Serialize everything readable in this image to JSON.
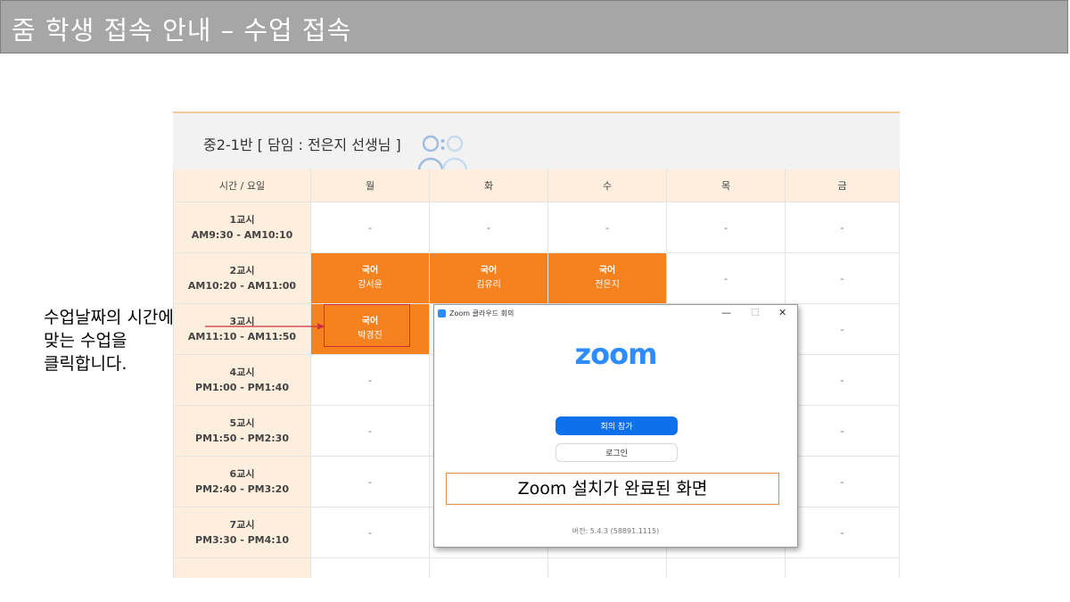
{
  "slide_title": "줌 학생 접속 안내 – 수업 접속",
  "timetable": {
    "class_title": "중2-1반 [ 담임 : 전은지 선생님 ]",
    "header": [
      "시간 / 요일",
      "월",
      "화",
      "수",
      "목",
      "금"
    ],
    "rows": [
      {
        "period": "1교시",
        "time": "AM9:30 - AM10:10",
        "cells": [
          {
            "text": "-"
          },
          {
            "text": "-"
          },
          {
            "text": "-"
          },
          {
            "text": "-"
          },
          {
            "text": "-"
          }
        ]
      },
      {
        "period": "2교시",
        "time": "AM10:20 - AM11:00",
        "cells": [
          {
            "subject": "국어",
            "teacher": "강서윤"
          },
          {
            "subject": "국어",
            "teacher": "김유리"
          },
          {
            "subject": "국어",
            "teacher": "전은지"
          },
          {
            "text": "-"
          },
          {
            "text": "-"
          }
        ]
      },
      {
        "period": "3교시",
        "time": "AM11:10 - AM11:50",
        "cells": [
          {
            "subject": "국어",
            "teacher": "박경진"
          },
          {
            "text": "-"
          },
          {
            "text": "-"
          },
          {
            "text": "-"
          },
          {
            "text": "-"
          }
        ]
      },
      {
        "period": "4교시",
        "time": "PM1:00 - PM1:40",
        "cells": [
          {
            "text": "-"
          },
          {
            "text": "-"
          },
          {
            "text": "-"
          },
          {
            "text": "-"
          },
          {
            "text": "-"
          }
        ]
      },
      {
        "period": "5교시",
        "time": "PM1:50 - PM2:30",
        "cells": [
          {
            "text": "-"
          },
          {
            "text": "-"
          },
          {
            "text": "-"
          },
          {
            "text": "-"
          },
          {
            "text": "-"
          }
        ]
      },
      {
        "period": "6교시",
        "time": "PM2:40 - PM3:20",
        "cells": [
          {
            "text": "-"
          },
          {
            "text": "-"
          },
          {
            "text": "-"
          },
          {
            "text": "-"
          },
          {
            "text": "-"
          }
        ]
      },
      {
        "period": "7교시",
        "time": "PM3:30 - PM4:10",
        "cells": [
          {
            "text": "-"
          },
          {
            "text": "-"
          },
          {
            "text": "-"
          },
          {
            "text": "-"
          },
          {
            "text": "-"
          }
        ]
      },
      {
        "period": "8교시",
        "time": "",
        "cells": [
          {
            "text": ""
          },
          {
            "text": ""
          },
          {
            "text": ""
          },
          {
            "text": ""
          },
          {
            "text": ""
          }
        ]
      }
    ]
  },
  "callout": {
    "lines": [
      "수업날짜의 시간에",
      "맞는 수업을",
      "클릭합니다."
    ]
  },
  "zoom_window": {
    "title": "Zoom 클라우드 회의",
    "logo": "zoom",
    "join_label": "회의 참가",
    "login_label": "로그인",
    "caption": "Zoom 설치가 완료된 화면",
    "version": "버전: 5.4.3 (58891.1115)",
    "minimize": "—",
    "maximize": "☐",
    "close": "✕"
  },
  "colors": {
    "title_bar": "#a6a6a6",
    "lesson_orange": "#f5821f",
    "header_peach": "#fdeedd",
    "zoom_blue": "#2d8cff",
    "highlight_red": "#d0303a"
  }
}
